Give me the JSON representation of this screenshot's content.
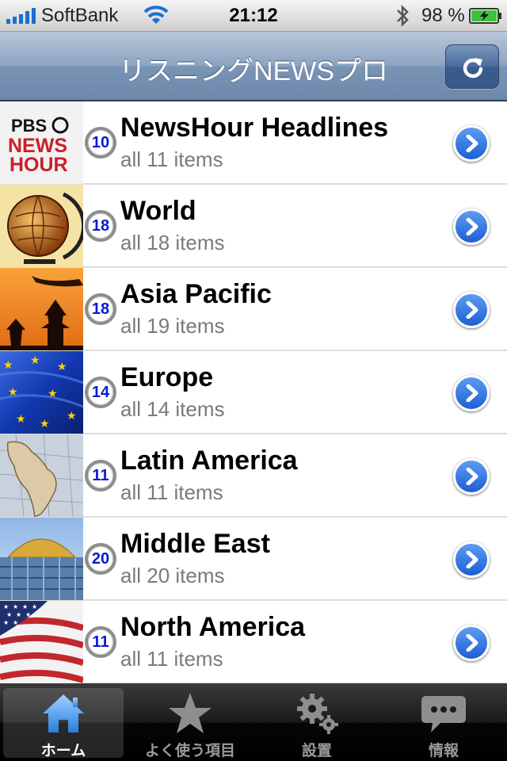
{
  "status_bar": {
    "carrier": "SoftBank",
    "time": "21:12",
    "battery_percent": "98 %"
  },
  "nav": {
    "title": "リスニングNEWSプロ",
    "refresh_icon": "refresh-icon"
  },
  "feeds": [
    {
      "title": "NewsHour Headlines",
      "subtitle": "all 11 items",
      "badge": "10",
      "thumbnail": "pbs-newshour-logo"
    },
    {
      "title": "World",
      "subtitle": "all 18 items",
      "badge": "18",
      "thumbnail": "globe-image"
    },
    {
      "title": "Asia Pacific",
      "subtitle": "all 19 items",
      "badge": "18",
      "thumbnail": "pagoda-sunset-image"
    },
    {
      "title": "Europe",
      "subtitle": "all 14 items",
      "badge": "14",
      "thumbnail": "eu-flag-image"
    },
    {
      "title": "Latin America",
      "subtitle": "all 11 items",
      "badge": "11",
      "thumbnail": "map-image"
    },
    {
      "title": "Middle East",
      "subtitle": "all 20 items",
      "badge": "20",
      "thumbnail": "dome-image"
    },
    {
      "title": "North America",
      "subtitle": "all 11 items",
      "badge": "11",
      "thumbnail": "us-flag-image"
    }
  ],
  "thumb_text": {
    "pbs": "PBS",
    "news": "NEWS",
    "hour": "HOUR"
  },
  "tabs": [
    {
      "label": "ホーム",
      "icon": "home-icon",
      "active": true
    },
    {
      "label": "よく使う項目",
      "icon": "star-icon",
      "active": false
    },
    {
      "label": "設置",
      "icon": "gears-icon",
      "active": false
    },
    {
      "label": "情報",
      "icon": "speech-bubble-icon",
      "active": false
    }
  ],
  "colors": {
    "badge_text": "#0a1ad0",
    "disclosure_blue": "#1e5fd3",
    "nav_bar": "#7a94b5"
  }
}
